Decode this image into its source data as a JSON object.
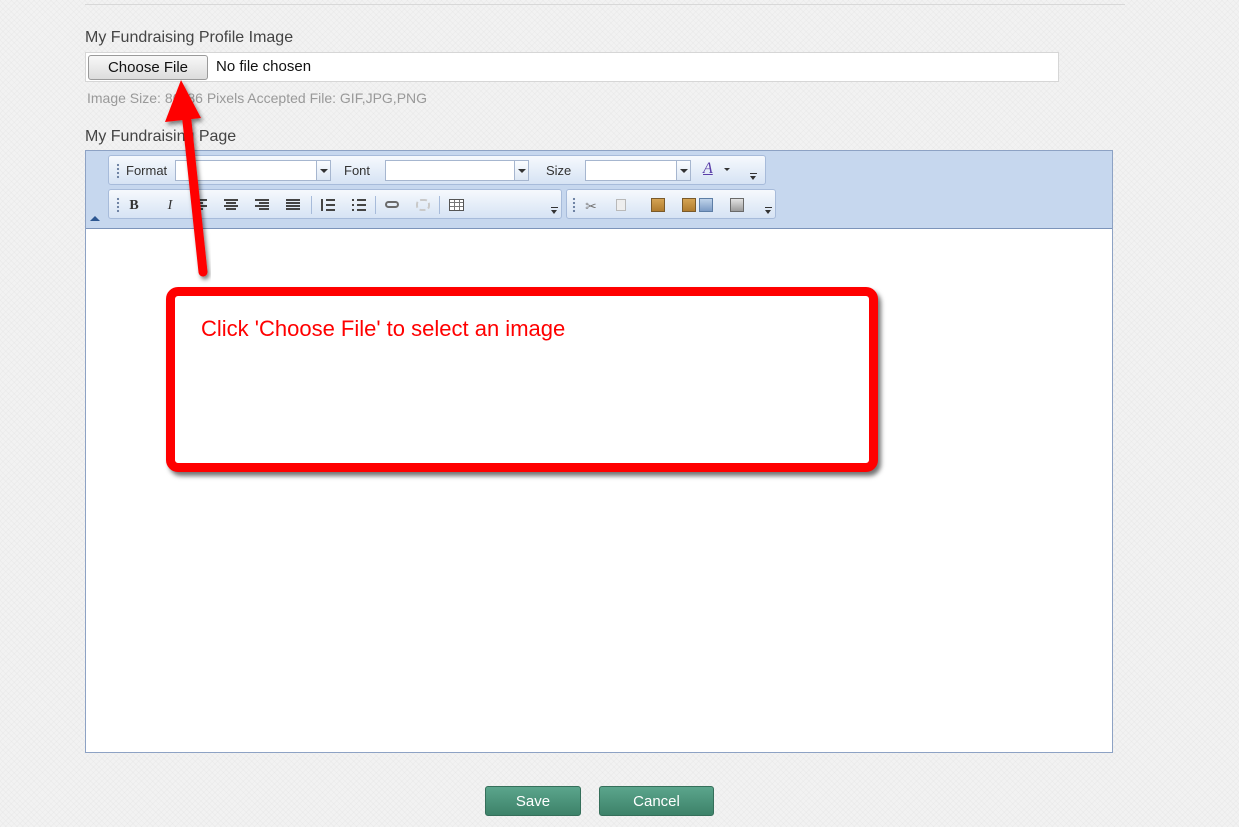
{
  "profile_image": {
    "label": "My Fundraising Profile Image",
    "choose_button": "Choose File",
    "file_status": "No file chosen",
    "hint": "Image Size: 86x86 Pixels Accepted File: GIF,JPG,PNG"
  },
  "page_editor": {
    "label": "My Fundraising Page",
    "toolbar": {
      "format_label": "Format",
      "font_label": "Font",
      "size_label": "Size",
      "text_color_glyph": "A",
      "bold": "B",
      "italic": "I"
    }
  },
  "annotation": {
    "text": "Click 'Choose File' to select an image",
    "color": "#ff0000"
  },
  "actions": {
    "save": "Save",
    "cancel": "Cancel",
    "button_color": "#4a9479"
  }
}
